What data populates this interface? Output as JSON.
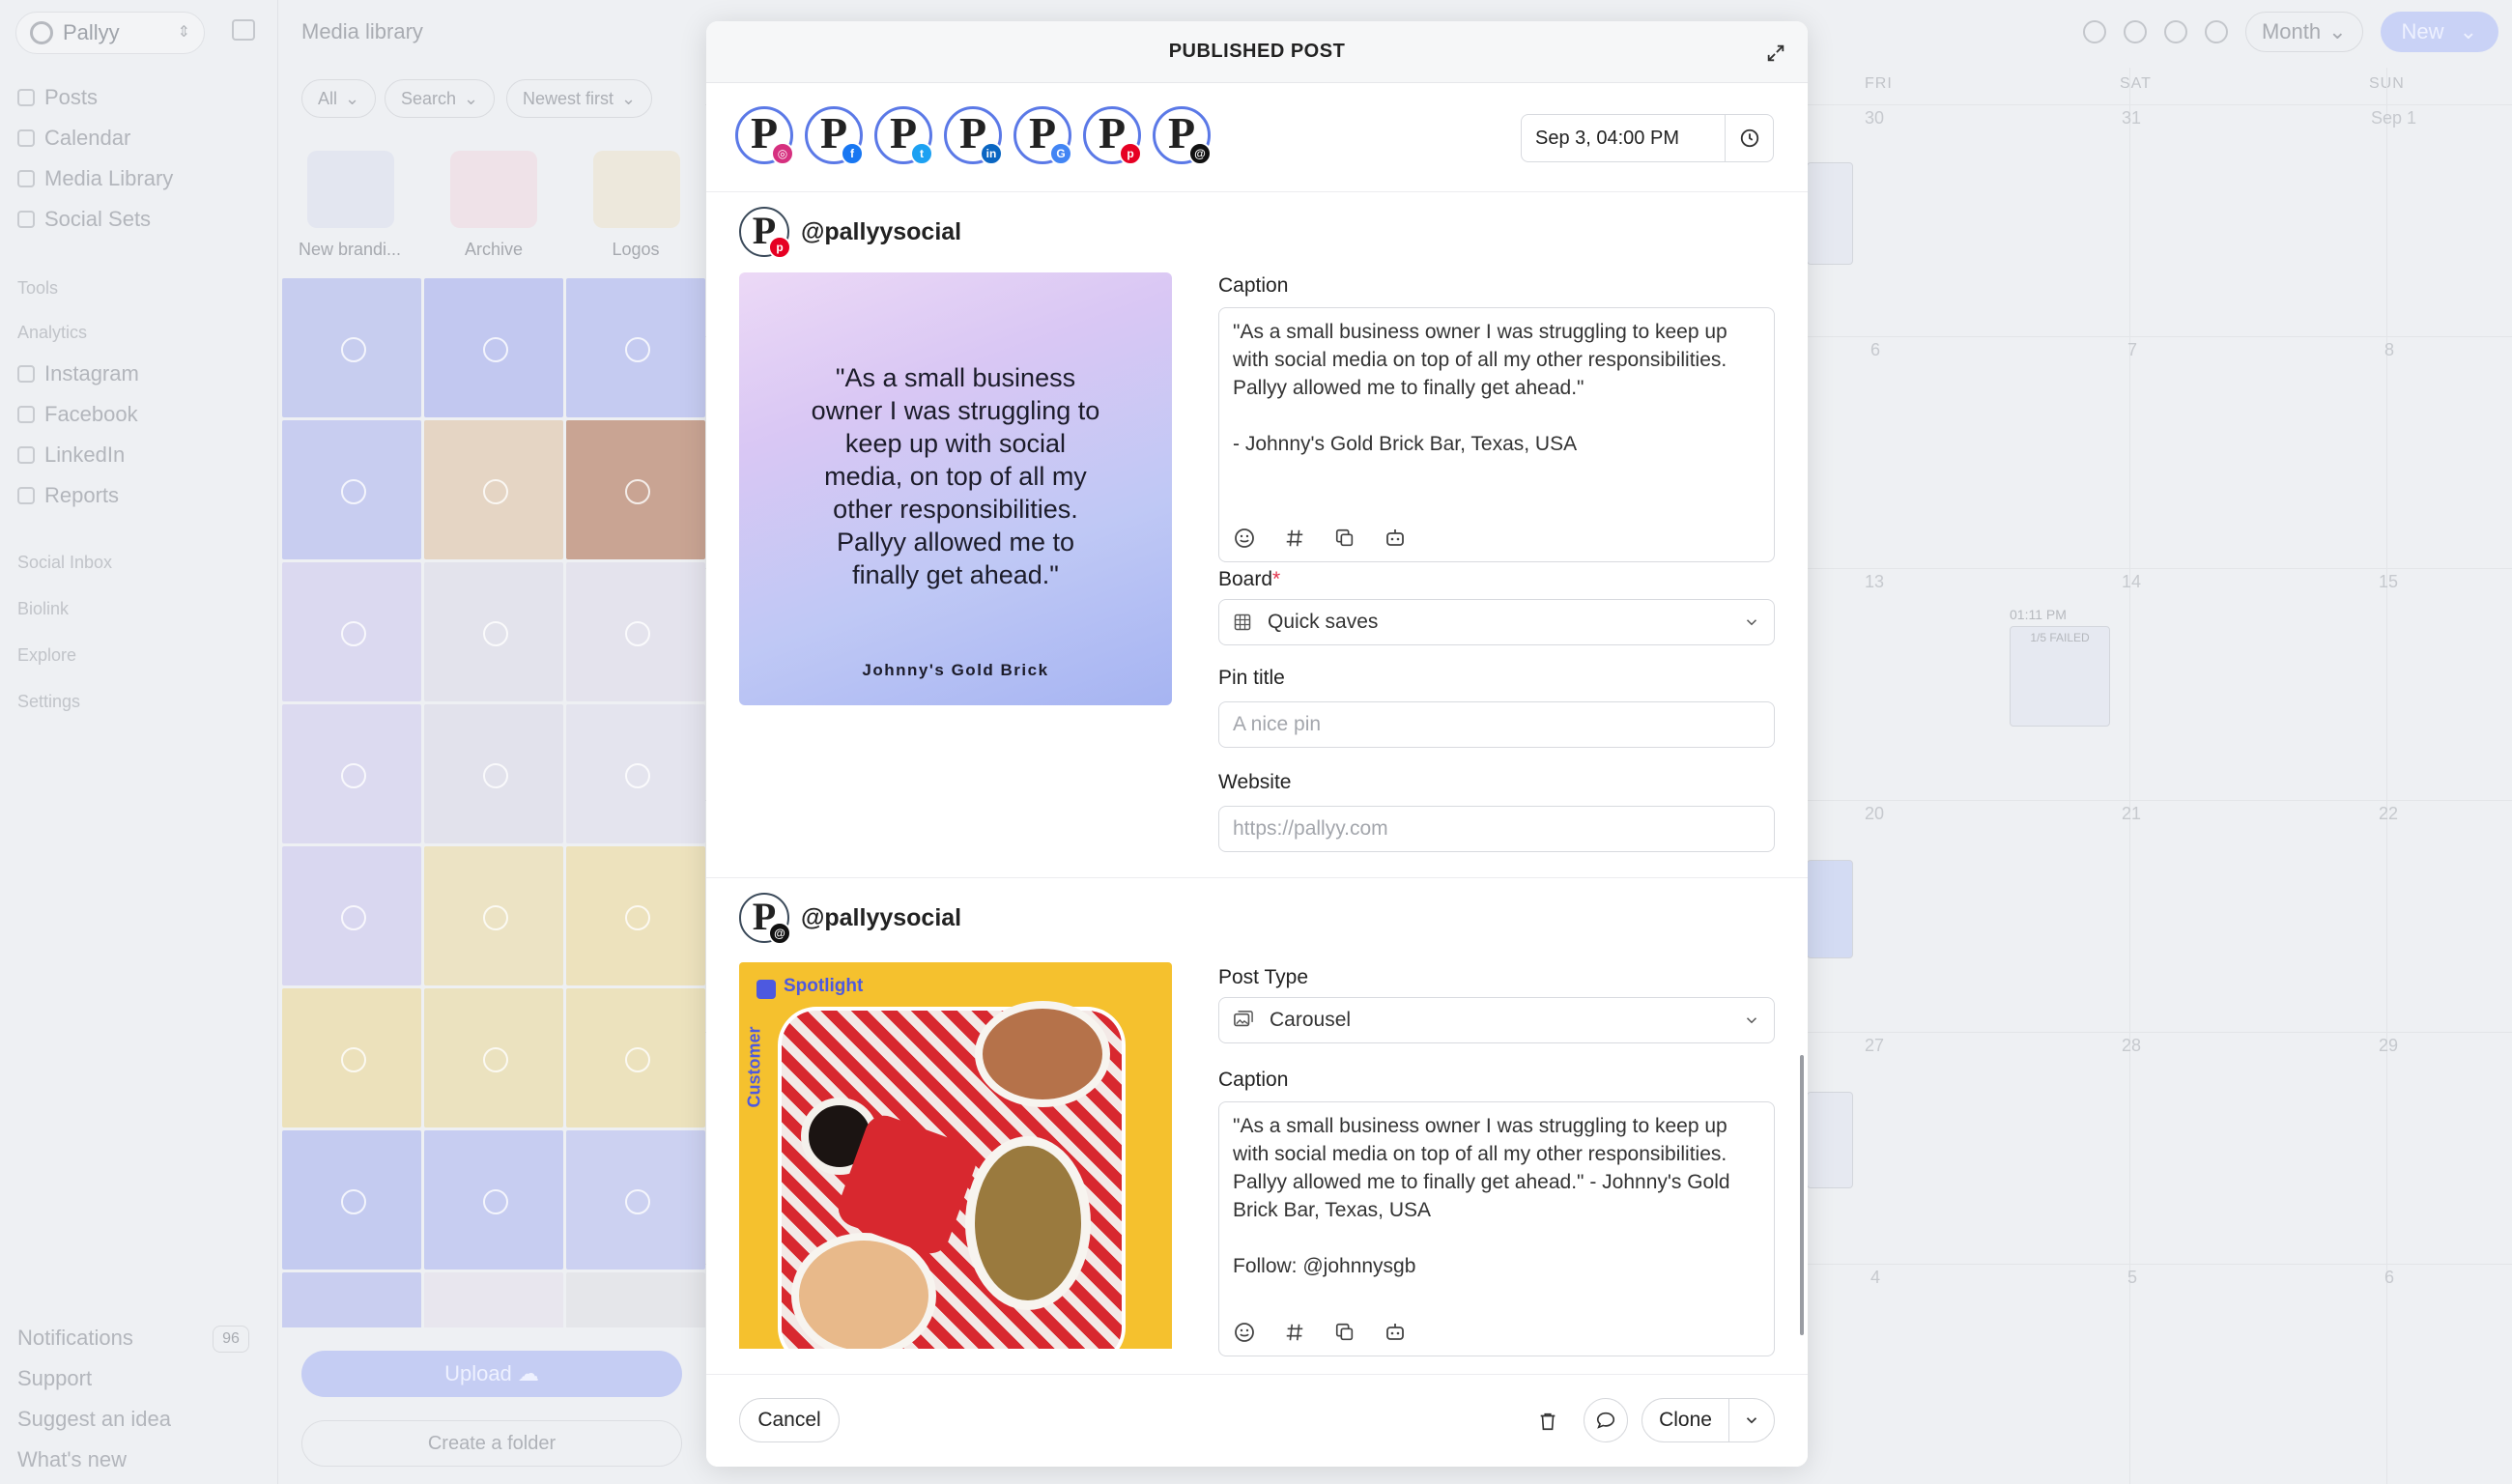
{
  "app": {
    "brand": "Pallyy",
    "nav": [
      "Posts",
      "Calendar",
      "Media Library",
      "Social Sets"
    ],
    "section_tools": "Tools",
    "section_analytics": "Analytics",
    "analytics_items": [
      "Instagram",
      "Facebook",
      "LinkedIn",
      "Reports"
    ],
    "more_sections": [
      "Social Inbox",
      "Biolink",
      "Explore",
      "Settings"
    ],
    "bottom_items": [
      "Notifications",
      "Support",
      "Suggest an idea",
      "What's new"
    ],
    "notifications_count": "96"
  },
  "media_library": {
    "title": "Media library",
    "filters": [
      "All",
      "Search",
      "Newest first"
    ],
    "folders": [
      "New brandi...",
      "Archive",
      "Logos"
    ],
    "upload_label": "Upload",
    "create_folder_label": "Create a folder"
  },
  "calendar": {
    "view_label": "Month",
    "new_label": "New",
    "days": [
      "FRI",
      "SAT",
      "SUN"
    ],
    "week_numbers": [
      [
        "30",
        "31",
        "Sep 1"
      ],
      [
        "6",
        "7",
        "8"
      ],
      [
        "13",
        "14",
        "15"
      ],
      [
        "20",
        "21",
        "22"
      ],
      [
        "27",
        "28",
        "29"
      ],
      [
        "4",
        "5",
        "6"
      ]
    ],
    "card_time": "01:11 PM",
    "card_status": "1/5 FAILED"
  },
  "modal": {
    "title": "PUBLISHED POST",
    "schedule_date": "Sep 3, 04:00 PM",
    "accounts": [
      {
        "network": "instagram",
        "color": "#d6307f"
      },
      {
        "network": "facebook",
        "color": "#1877f2"
      },
      {
        "network": "twitter",
        "color": "#1da1f2"
      },
      {
        "network": "linkedin",
        "color": "#0a66c2"
      },
      {
        "network": "google-business",
        "color": "#4285f4"
      },
      {
        "network": "pinterest",
        "color": "#e60023"
      },
      {
        "network": "threads",
        "color": "#111111"
      }
    ],
    "pinterest_post": {
      "handle": "@pallyysocial",
      "image_quote": "\"As a small business owner I was struggling to keep up with social media, on top of all my other responsibilities. Pallyy allowed me to finally get ahead.\"",
      "image_brand": "Johnny's Gold Brick",
      "caption_label": "Caption",
      "caption": "\"As a small business owner I was struggling to keep up with social media on top of all my other responsibilities. Pallyy allowed me to finally get ahead.\"\n\n- Johnny's Gold Brick Bar, Texas, USA",
      "board_label": "Board",
      "board_required": "*",
      "board_value": "Quick saves",
      "pin_title_label": "Pin title",
      "pin_title_placeholder": "A nice pin",
      "website_label": "Website",
      "website_placeholder": "https://pallyy.com"
    },
    "threads_post": {
      "handle": "@pallyysocial",
      "image_badge": "Spotlight",
      "image_side_label": "Customer",
      "post_type_label": "Post Type",
      "post_type_value": "Carousel",
      "caption_label": "Caption",
      "caption": "\"As a small business owner I was struggling to keep up with social media on top of all my other responsibilities. Pallyy allowed me to finally get ahead.\" - Johnny's Gold Brick Bar, Texas, USA\n\nFollow: @johnnysgb"
    },
    "footer": {
      "cancel_label": "Cancel",
      "clone_label": "Clone"
    }
  }
}
